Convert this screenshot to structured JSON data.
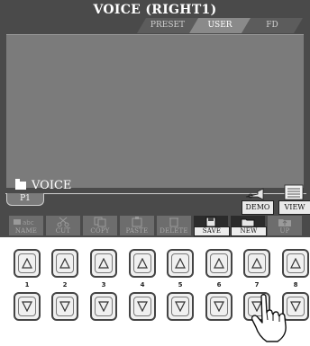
{
  "screen": {
    "title": "VOICE (RIGHT1)",
    "tabs": [
      {
        "label": "PRESET",
        "active": false
      },
      {
        "label": "USER",
        "active": true
      },
      {
        "label": "FD",
        "active": false
      }
    ],
    "folder_label": "VOICE",
    "page_tab": "P1",
    "side_buttons": {
      "demo": "DEMO",
      "view": "VIEW"
    },
    "function_buttons": [
      {
        "label": "NAME",
        "icon": "name-icon",
        "active": false
      },
      {
        "label": "CUT",
        "icon": "scissors-icon",
        "active": false
      },
      {
        "label": "COPY",
        "icon": "copy-icon",
        "active": false
      },
      {
        "label": "PASTE",
        "icon": "paste-icon",
        "active": false
      },
      {
        "label": "DELETE",
        "icon": "trash-icon",
        "active": false
      },
      {
        "label": "SAVE",
        "icon": "floppy-icon",
        "active": true
      },
      {
        "label": "NEW",
        "icon": "new-folder-icon",
        "active": true
      },
      {
        "label": "UP",
        "icon": "up-folder-icon",
        "active": false
      }
    ],
    "name_icon_text": "abc"
  },
  "hardware": {
    "numbers": [
      "1",
      "2",
      "3",
      "4",
      "5",
      "6",
      "7",
      "8"
    ],
    "up_icon": "triangle-up-icon",
    "down_icon": "triangle-down-icon",
    "pointer": "hand-pointer-icon"
  },
  "colors": {
    "screen_bg": "#4a4a4a",
    "browser_bg": "#7b7b7b",
    "active_tab": "#8a8a8a"
  }
}
